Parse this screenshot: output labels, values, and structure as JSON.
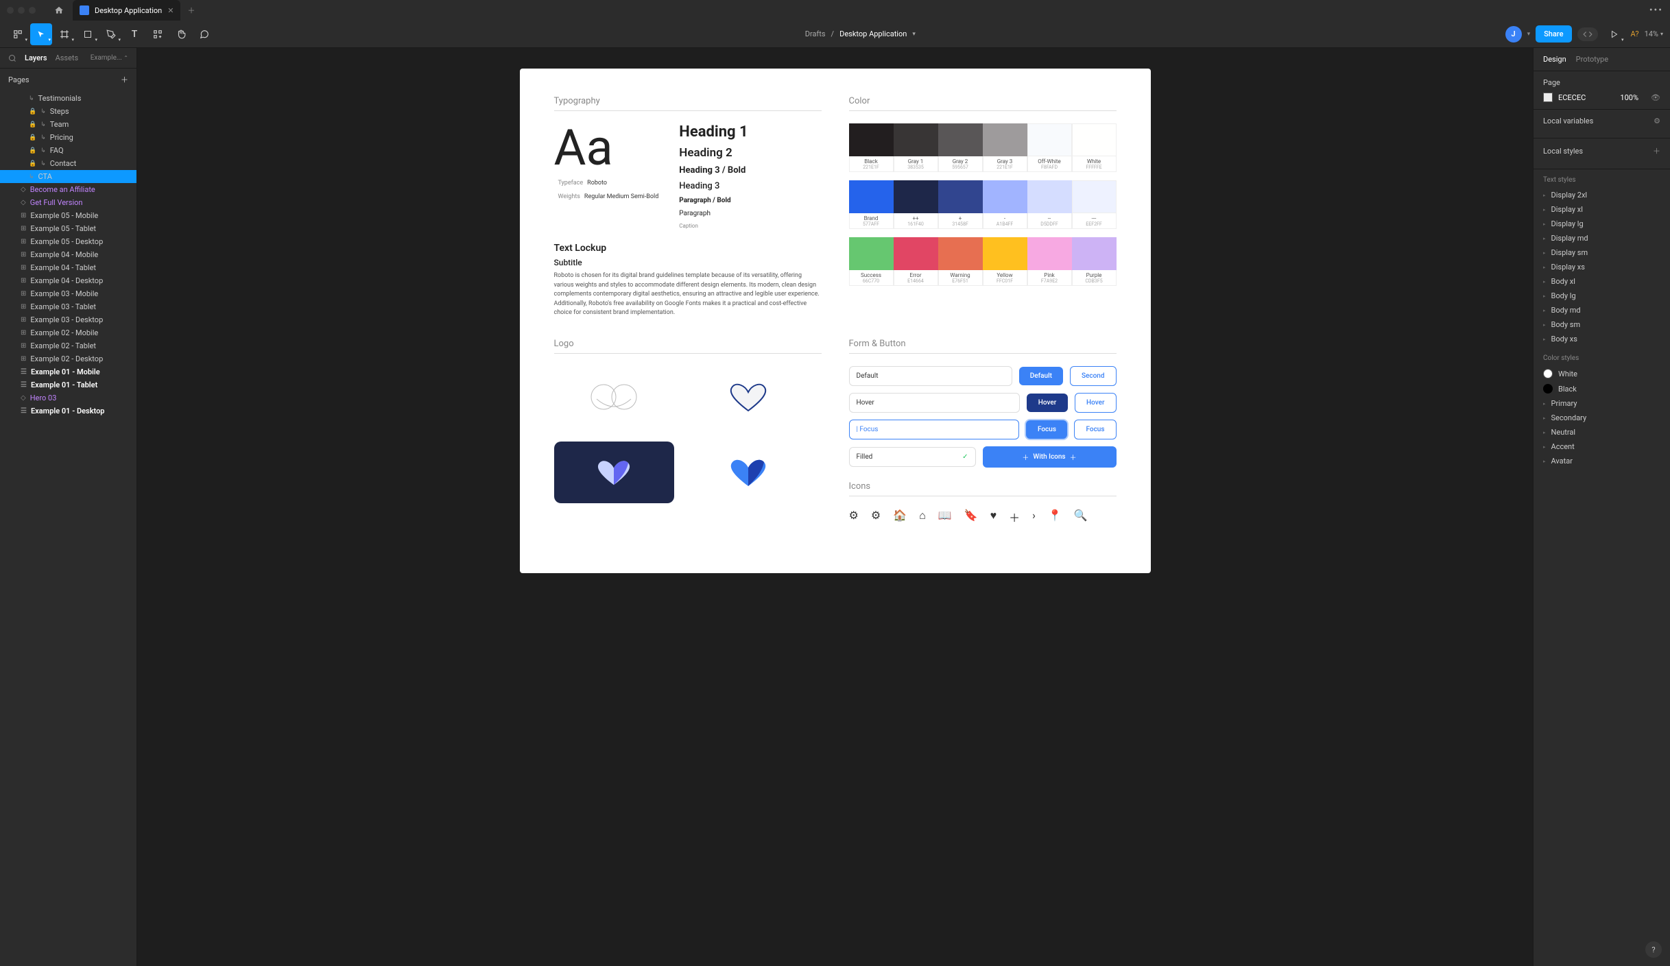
{
  "titlebar": {
    "tab_name": "Desktop Application"
  },
  "toolbar": {
    "breadcrumb_parent": "Drafts",
    "breadcrumb_current": "Desktop Application",
    "avatar_initial": "J",
    "share_label": "Share",
    "a_question": "A?",
    "zoom_label": "14%"
  },
  "left_panel": {
    "tab_layers": "Layers",
    "tab_assets": "Assets",
    "tab_example": "Example...",
    "pages_label": "Pages",
    "layers": [
      {
        "label": "Testimonials",
        "nested": true,
        "lock": false,
        "arrow": true
      },
      {
        "label": "Steps",
        "nested": true,
        "lock": true,
        "arrow": true
      },
      {
        "label": "Team",
        "nested": true,
        "lock": true,
        "arrow": true
      },
      {
        "label": "Pricing",
        "nested": true,
        "lock": true,
        "arrow": true
      },
      {
        "label": "FAQ",
        "nested": true,
        "lock": true,
        "arrow": true
      },
      {
        "label": "Contact",
        "nested": true,
        "lock": true,
        "arrow": true
      },
      {
        "label": "CTA",
        "nested": true,
        "lock": false,
        "arrow": true,
        "selected": true
      },
      {
        "label": "Become an Affiliate",
        "purple": true,
        "diamond": true
      },
      {
        "label": "Get Full Version",
        "purple": true,
        "diamond": true
      },
      {
        "label": "Example 05 - Mobile",
        "frame": true
      },
      {
        "label": "Example 05 - Tablet",
        "frame": true
      },
      {
        "label": "Example 05 - Desktop",
        "frame": true
      },
      {
        "label": "Example 04 - Mobile",
        "frame": true
      },
      {
        "label": "Example 04 - Tablet",
        "frame": true
      },
      {
        "label": "Example 04 - Desktop",
        "frame": true
      },
      {
        "label": "Example 03 - Mobile",
        "frame": true
      },
      {
        "label": "Example 03 - Tablet",
        "frame": true
      },
      {
        "label": "Example 03 - Desktop",
        "frame": true
      },
      {
        "label": "Example 02 - Mobile",
        "frame": true
      },
      {
        "label": "Example 02 - Tablet",
        "frame": true
      },
      {
        "label": "Example 02 - Desktop",
        "frame": true
      },
      {
        "label": "Example 01 - Mobile",
        "bold": true,
        "burger": true
      },
      {
        "label": "Example 01 - Tablet",
        "bold": true,
        "burger": true
      },
      {
        "label": "Hero 03",
        "purple": true,
        "diamond": true
      },
      {
        "label": "Example 01 - Desktop",
        "bold": true,
        "burger": true
      }
    ]
  },
  "canvas": {
    "typography": {
      "title": "Typography",
      "sample": "Aa",
      "typeface_label": "Typeface",
      "typeface_value": "Roboto",
      "weights_label": "Weights",
      "weights_value": "Regular  Medium  Semi-Bold",
      "h1": "Heading 1",
      "h2": "Heading 2",
      "h3b": "Heading 3 / Bold",
      "h3": "Heading 3",
      "pb": "Paragraph / Bold",
      "p": "Paragraph",
      "cap": "Caption",
      "lockup_title": "Text Lockup",
      "lockup_sub": "Subtitle",
      "lockup_body": "Roboto is chosen for its digital brand guidelines template because of its versatility, offering various weights and styles to accommodate different design elements. Its modern, clean design complements contemporary digital aesthetics, ensuring an attractive and legible user experience. Additionally, Roboto's free availability on Google Fonts makes it a practical and cost-effective choice for consistent brand implementation."
    },
    "color": {
      "title": "Color",
      "row1": [
        {
          "name": "Black",
          "hex": "221E1F",
          "c": "#221E1F"
        },
        {
          "name": "Gray 1",
          "hex": "383535",
          "c": "#383535"
        },
        {
          "name": "Gray 2",
          "hex": "595657",
          "c": "#595657"
        },
        {
          "name": "Gray 3",
          "hex": "221E1F",
          "c": "#9e9b9c"
        },
        {
          "name": "Off-White",
          "hex": "F8FAFD",
          "c": "#F8FAFD"
        },
        {
          "name": "White",
          "hex": "FFFFFE",
          "c": "#FFFFFE"
        }
      ],
      "row2": [
        {
          "name": "Brand",
          "hex": "577AFF",
          "c": "#2563eb"
        },
        {
          "name": "++",
          "hex": "161F40",
          "c": "#1e2749"
        },
        {
          "name": "+",
          "hex": "31458F",
          "c": "#31458F"
        },
        {
          "name": "-",
          "hex": "A1B4FF",
          "c": "#A1B4FF"
        },
        {
          "name": "--",
          "hex": "D5DDFF",
          "c": "#D5DDFF"
        },
        {
          "name": "---",
          "hex": "EEF2FF",
          "c": "#EEF2FF"
        }
      ],
      "row3": [
        {
          "name": "Success",
          "hex": "66C770",
          "c": "#66C770"
        },
        {
          "name": "Error",
          "hex": "E14664",
          "c": "#E14664"
        },
        {
          "name": "Warning",
          "hex": "E76F51",
          "c": "#E76F51"
        },
        {
          "name": "Yellow",
          "hex": "FFC01F",
          "c": "#FFC01F"
        },
        {
          "name": "Pink",
          "hex": "F7A9E2",
          "c": "#F7A9E2"
        },
        {
          "name": "Purple",
          "hex": "CDB3F5",
          "c": "#CDB3F5"
        }
      ]
    },
    "logo_title": "Logo",
    "form": {
      "title": "Form & Button",
      "default": "Default",
      "hover": "Hover",
      "focus": "Focus",
      "filled": "Filled",
      "second": "Second",
      "with_icons": "With Icons"
    },
    "icons_title": "Icons"
  },
  "right_panel": {
    "tab_design": "Design",
    "tab_prototype": "Prototype",
    "page_label": "Page",
    "page_hex": "ECECEC",
    "page_opacity": "100%",
    "local_vars": "Local variables",
    "local_styles": "Local styles",
    "text_styles_label": "Text styles",
    "text_styles": [
      "Display 2xl",
      "Display xl",
      "Display lg",
      "Display md",
      "Display sm",
      "Display xs",
      "Body xl",
      "Body lg",
      "Body md",
      "Body sm",
      "Body xs"
    ],
    "color_styles_label": "Color styles",
    "color_styles": [
      {
        "name": "White",
        "dot": "#ffffff"
      },
      {
        "name": "Black",
        "dot": "#000000"
      },
      {
        "name": "Primary"
      },
      {
        "name": "Secondary"
      },
      {
        "name": "Neutral"
      },
      {
        "name": "Accent"
      },
      {
        "name": "Avatar"
      }
    ]
  }
}
